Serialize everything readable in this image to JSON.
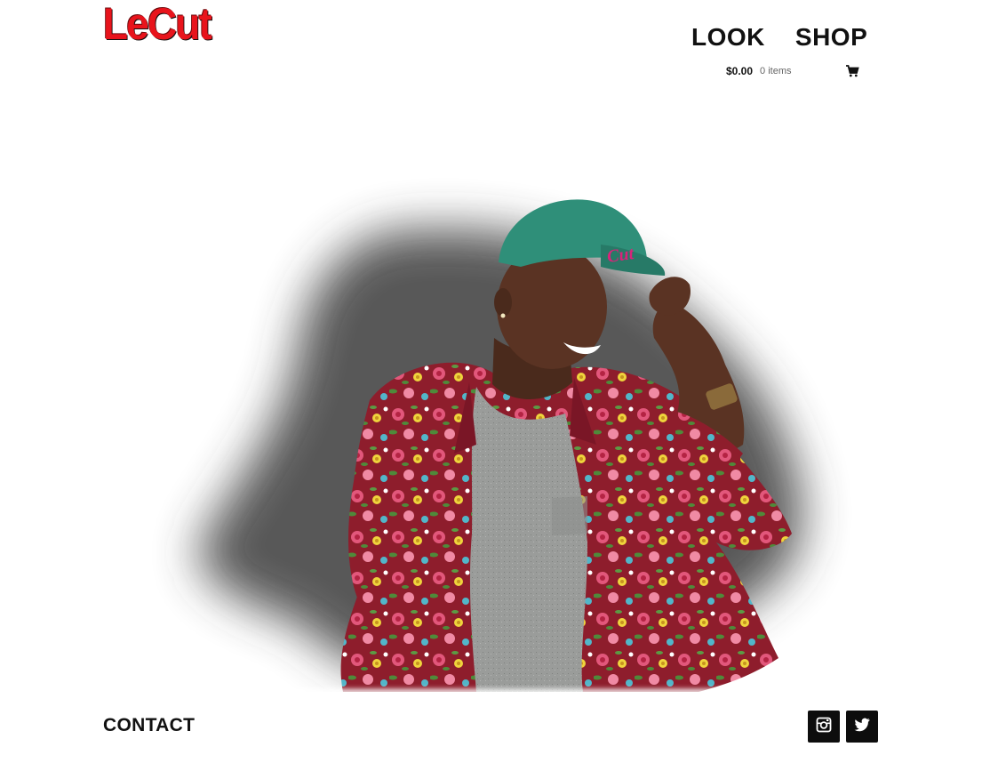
{
  "header": {
    "logo_text": "LeCut",
    "brand_color": "#e8141c"
  },
  "nav": {
    "items": [
      {
        "label": "LOOK"
      },
      {
        "label": "SHOP"
      }
    ]
  },
  "cart": {
    "amount": "$0.00",
    "items_label": "0 items",
    "icon": "cart-icon"
  },
  "hero": {
    "image": "model-in-floral-shirt-and-green-cap-photo",
    "cap_text": "Cut",
    "colors": {
      "cap": "#2f8f79",
      "shirt": "#8e1d2c",
      "tee": "#9a9c9a",
      "shadow": "#3a3a3a"
    }
  },
  "footer": {
    "contact_label": "CONTACT",
    "social": [
      {
        "icon": "instagram-icon"
      },
      {
        "icon": "twitter-icon"
      }
    ]
  }
}
